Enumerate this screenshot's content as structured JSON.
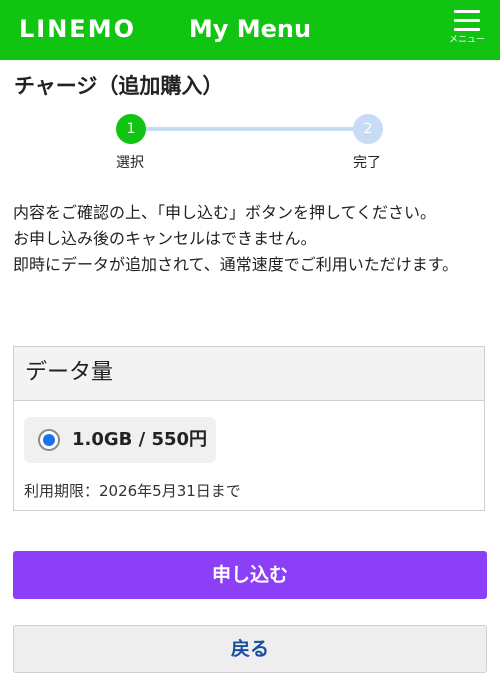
{
  "header": {
    "logo": "LINEMO",
    "title": "My Menu",
    "menu_label": "メニュー"
  },
  "page_title": "チャージ（追加購入）",
  "stepper": {
    "steps": [
      {
        "number": "1",
        "label": "選択"
      },
      {
        "number": "2",
        "label": "完了"
      }
    ]
  },
  "notice": [
    "内容をご確認の上、「申し込む」ボタンを押してください。",
    "お申し込み後のキャンセルはできません。",
    "即時にデータが追加されて、通常速度でご利用いただけます。"
  ],
  "data_section": {
    "heading": "データ量",
    "option_label": "1.0GB / 550円",
    "expiry": "利用期限：2026年5月31日まで"
  },
  "buttons": {
    "apply": "申し込む",
    "back": "戻る"
  },
  "colors": {
    "brand_green": "#12c412",
    "apply_purple": "#8b3ff7",
    "step_inactive": "#c8dcf5",
    "radio_blue": "#1a73e8"
  }
}
